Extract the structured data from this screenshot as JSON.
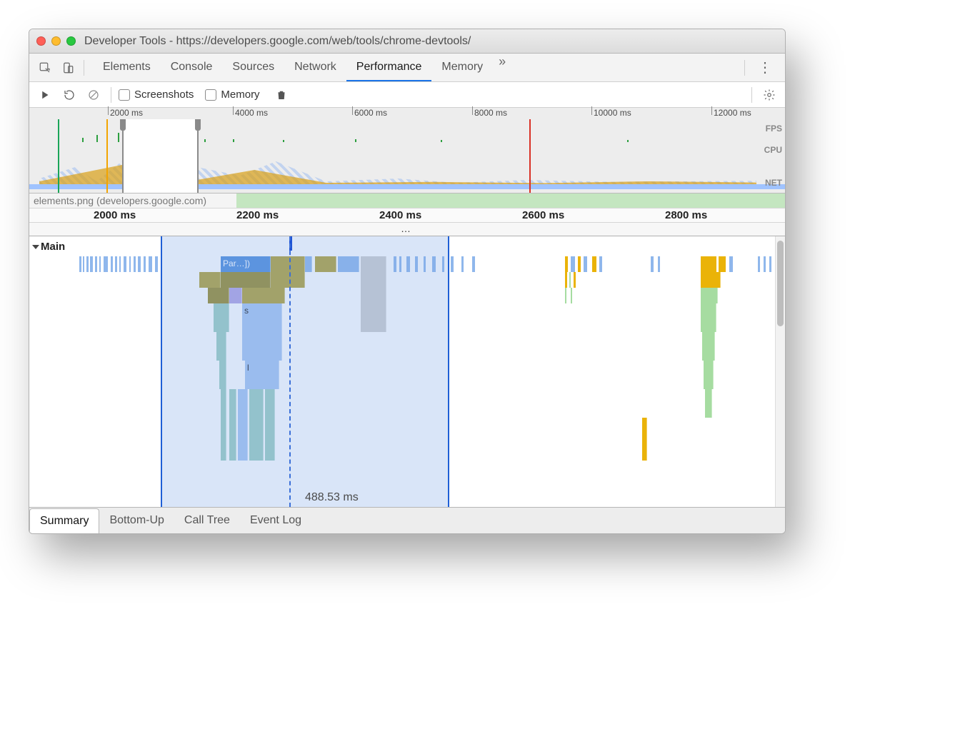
{
  "window": {
    "title": "Developer Tools - https://developers.google.com/web/tools/chrome-devtools/"
  },
  "tabs": {
    "items": [
      "Elements",
      "Console",
      "Sources",
      "Network",
      "Performance",
      "Memory"
    ],
    "active": "Performance",
    "more_glyph": "»",
    "menu_glyph": "⋮"
  },
  "toolbar": {
    "screenshots_label": "Screenshots",
    "memory_label": "Memory"
  },
  "overview": {
    "ticks": [
      "2000 ms",
      "4000 ms",
      "6000 ms",
      "8000 ms",
      "10000 ms",
      "12000 ms"
    ],
    "lane_labels": [
      "FPS",
      "CPU",
      "NET"
    ]
  },
  "netrow": {
    "label": "elements.png (developers.google.com)"
  },
  "ruler2": {
    "ticks": [
      "2000 ms",
      "2200 ms",
      "2400 ms",
      "2600 ms",
      "2800 ms"
    ]
  },
  "ellipsis": "…",
  "flame": {
    "main_label": "Main",
    "selection_duration": "488.53 ms",
    "task_label": "Par…])",
    "s_label": "s",
    "l_label": "l"
  },
  "bottom_tabs": {
    "items": [
      "Summary",
      "Bottom-Up",
      "Call Tree",
      "Event Log"
    ],
    "active": "Summary"
  }
}
